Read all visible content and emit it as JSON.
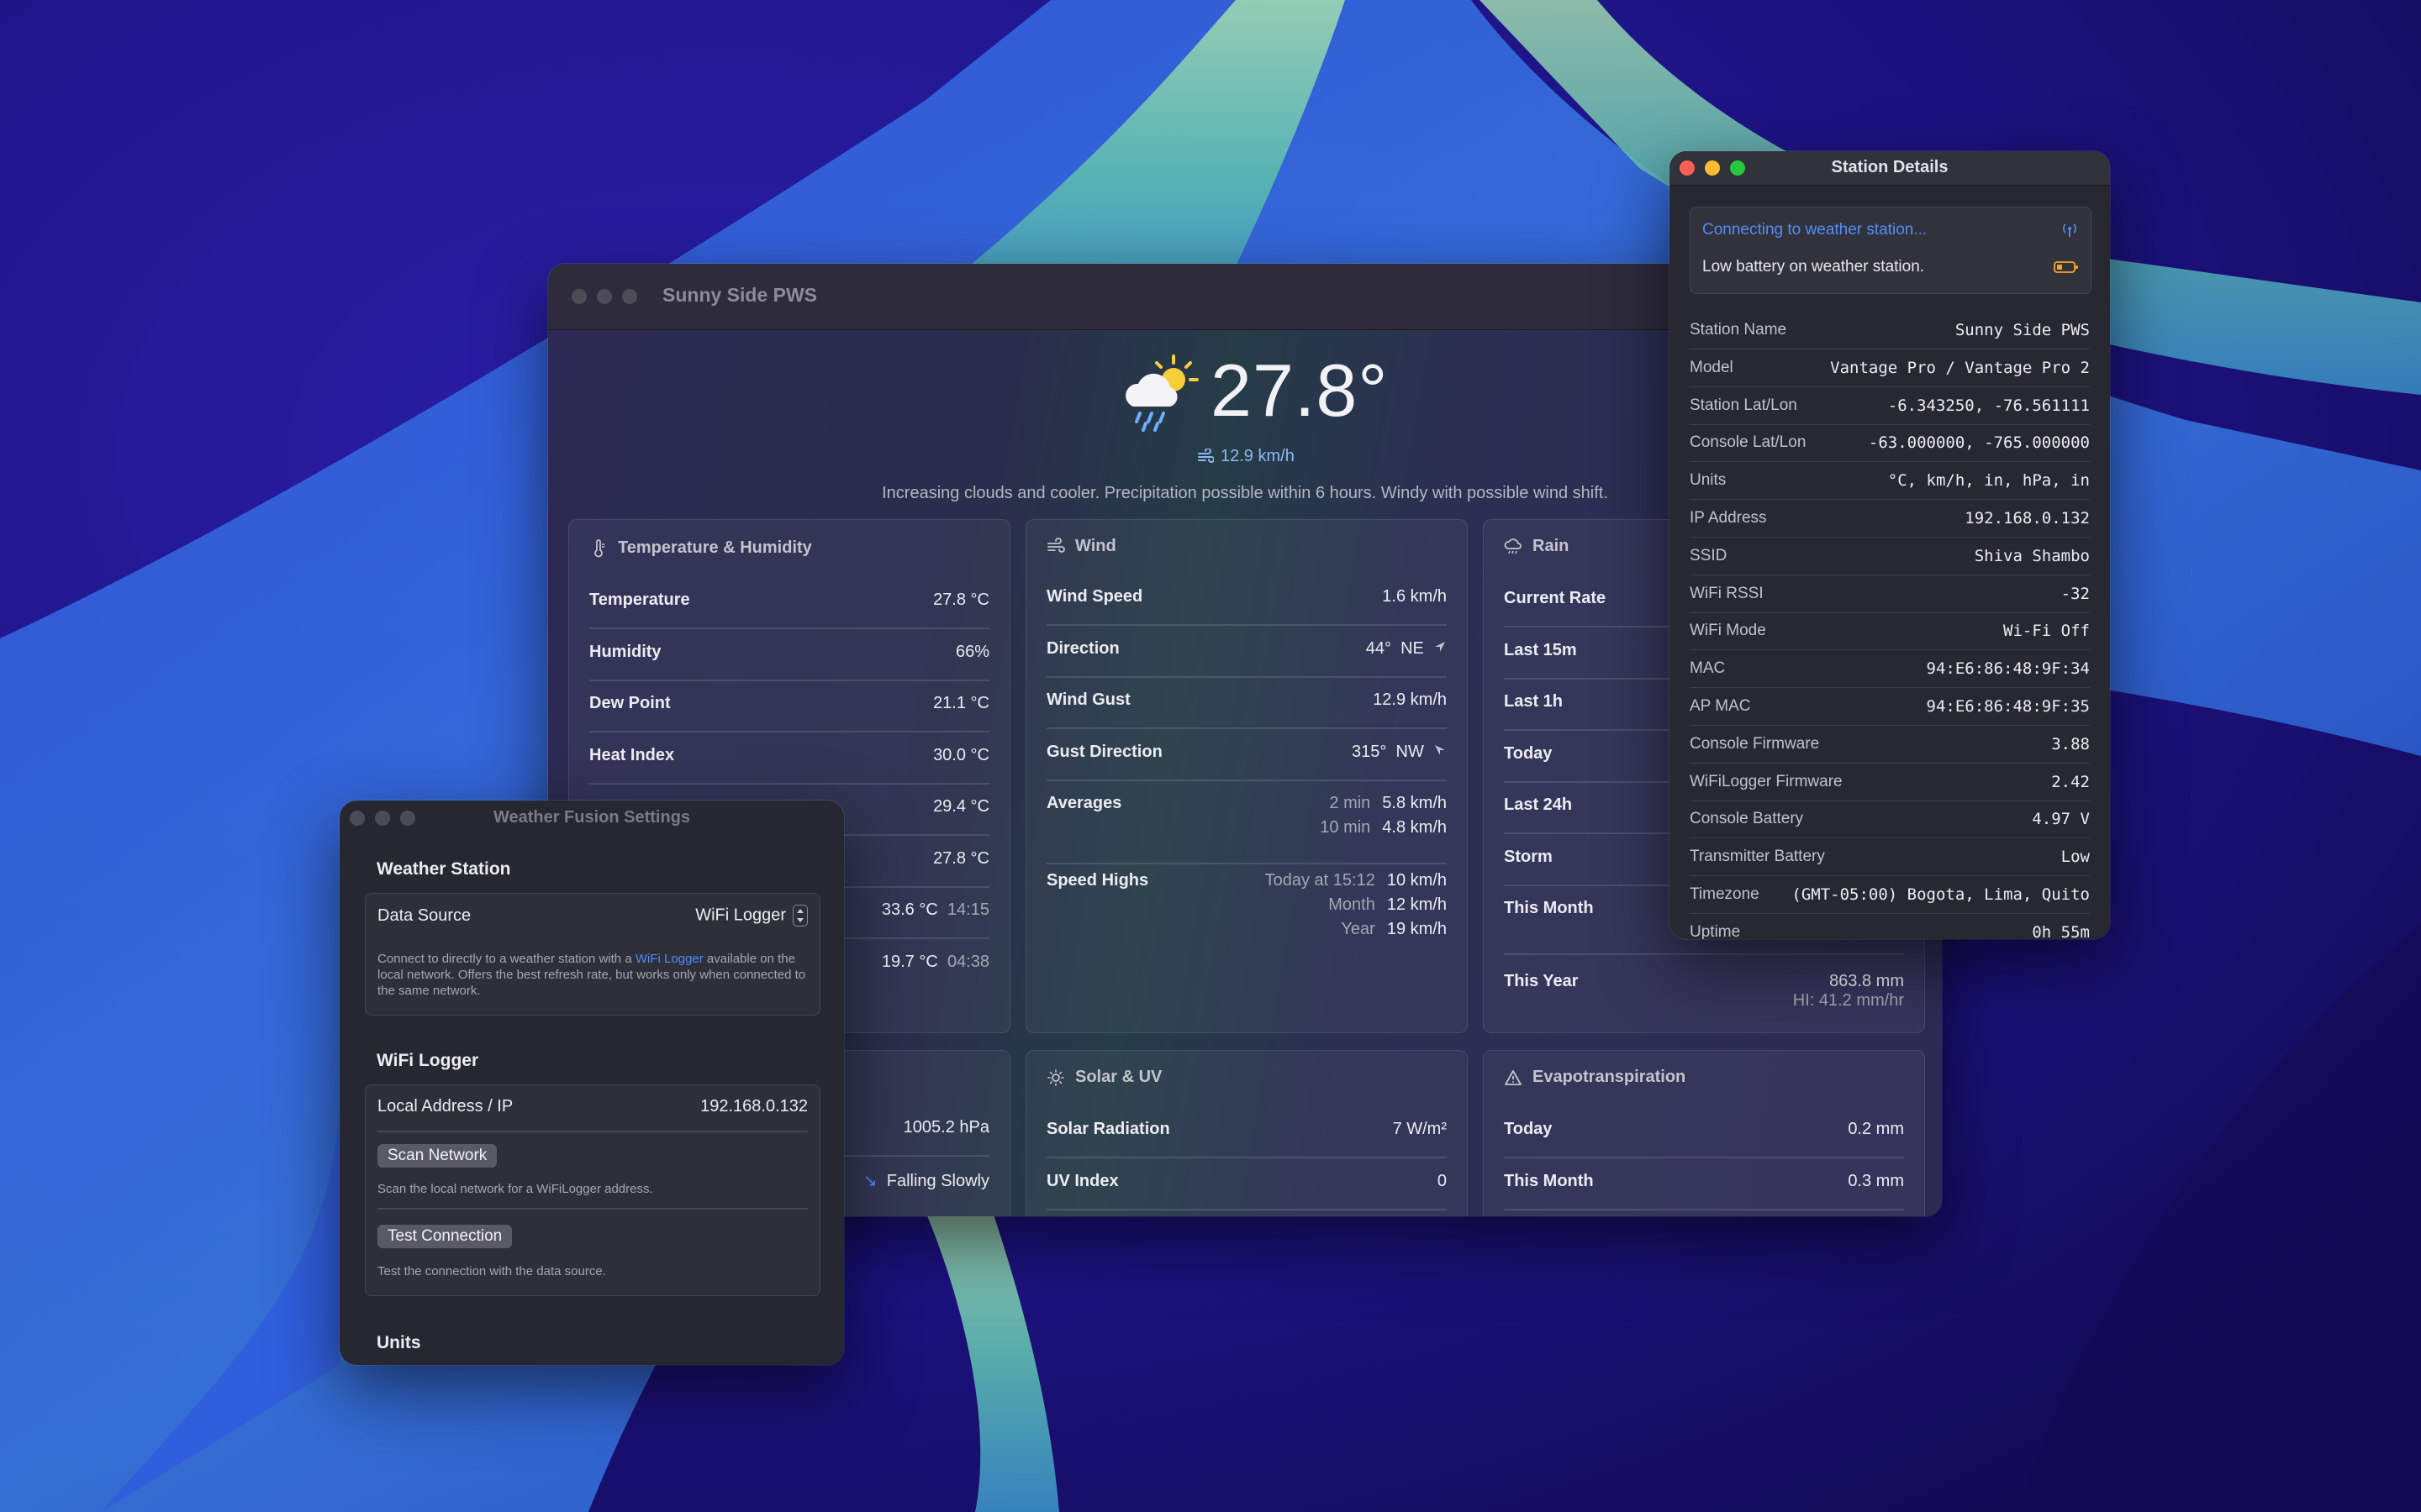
{
  "main_window": {
    "title": "Sunny Side PWS",
    "current": {
      "temperature": "27.8°",
      "wind": "12.9 km/h",
      "forecast": "Increasing clouds and cooler. Precipitation possible within 6 hours. Windy with possible wind shift."
    },
    "temperature_humidity": {
      "title": "Temperature & Humidity",
      "rows": [
        {
          "label": "Temperature",
          "value": "27.8 °C"
        },
        {
          "label": "Humidity",
          "value": "66%"
        },
        {
          "label": "Dew Point",
          "value": "21.1 °C"
        },
        {
          "label": "Heat Index",
          "value": "30.0 °C"
        },
        {
          "label": "",
          "value": "29.4 °C"
        },
        {
          "label": "",
          "value": "27.8 °C"
        },
        {
          "label": "",
          "value": "33.6 °C",
          "time": "14:15"
        },
        {
          "label": "",
          "value": "19.7 °C",
          "time": "04:38"
        }
      ]
    },
    "wind": {
      "title": "Wind",
      "speed_label": "Wind Speed",
      "speed": "1.6 km/h",
      "direction_label": "Direction",
      "direction_deg": "44°",
      "direction_card": "NE",
      "gust_label": "Wind Gust",
      "gust": "12.9 km/h",
      "gust_dir_label": "Gust Direction",
      "gust_dir_deg": "315°",
      "gust_dir_card": "NW",
      "averages_label": "Averages",
      "averages": [
        {
          "period": "2 min",
          "value": "5.8 km/h"
        },
        {
          "period": "10 min",
          "value": "4.8 km/h"
        }
      ],
      "highs_label": "Speed Highs",
      "highs": [
        {
          "period": "Today at 15:12",
          "value": "10 km/h"
        },
        {
          "period": "Month",
          "value": "12 km/h"
        },
        {
          "period": "Year",
          "value": "19 km/h"
        }
      ]
    },
    "rain": {
      "title": "Rain",
      "rows": [
        "Current Rate",
        "Last 15m",
        "Last 1h",
        "Today",
        "Last 24h",
        "Storm",
        "This Month"
      ],
      "year_label": "This Year",
      "year_value": "863.8 mm",
      "year_high": "HI: 41.2 mm/hr"
    },
    "pressure": {
      "value": "1005.2 hPa",
      "trend": "Falling Slowly"
    },
    "solar_uv": {
      "title": "Solar & UV",
      "rows": [
        {
          "label": "Solar Radiation",
          "value": "7 W/m²"
        },
        {
          "label": "UV Index",
          "value": "0"
        }
      ]
    },
    "evapotranspiration": {
      "title": "Evapotranspiration",
      "rows": [
        {
          "label": "Today",
          "value": "0.2 mm"
        },
        {
          "label": "This Month",
          "value": "0.3 mm"
        }
      ]
    }
  },
  "settings_window": {
    "title": "Weather Fusion Settings",
    "weather_station": {
      "title": "Weather Station",
      "data_source_label": "Data Source",
      "data_source_value": "WiFi Logger",
      "note_before": "Connect to directly to a weather station with a ",
      "note_link": "WiFi Logger",
      "note_after": " available on the local network. Offers the best refresh rate, but works only when connected to the same network."
    },
    "wifi_logger": {
      "title": "WiFi Logger",
      "address_label": "Local Address / IP",
      "address_value": "192.168.0.132",
      "scan_button": "Scan Network",
      "scan_note": "Scan the local network for a WiFiLogger address.",
      "test_button": "Test Connection",
      "test_note": "Test the connection with the data source."
    },
    "units_title": "Units"
  },
  "details_window": {
    "title": "Station Details",
    "alerts": [
      {
        "text": "Connecting to weather station...",
        "icon": "antenna-icon"
      },
      {
        "text": "Low battery on weather station.",
        "icon": "battery-low-icon"
      }
    ],
    "rows": [
      {
        "label": "Station Name",
        "value": "Sunny Side PWS"
      },
      {
        "label": "Model",
        "value": "Vantage Pro / Vantage Pro 2"
      },
      {
        "label": "Station Lat/Lon",
        "value": "-6.343250, -76.561111"
      },
      {
        "label": "Console Lat/Lon",
        "value": "-63.000000, -765.000000"
      },
      {
        "label": "Units",
        "value": "°C, km/h, in, hPa, in"
      },
      {
        "label": "IP Address",
        "value": "192.168.0.132"
      },
      {
        "label": "SSID",
        "value": "Shiva Shambo"
      },
      {
        "label": "WiFi RSSI",
        "value": "-32"
      },
      {
        "label": "WiFi Mode",
        "value": "Wi-Fi Off"
      },
      {
        "label": "MAC",
        "value": "94:E6:86:48:9F:34"
      },
      {
        "label": "AP MAC",
        "value": "94:E6:86:48:9F:35"
      },
      {
        "label": "Console Firmware",
        "value": "3.88"
      },
      {
        "label": "WiFiLogger Firmware",
        "value": "2.42"
      },
      {
        "label": "Console Battery",
        "value": "4.97 V"
      },
      {
        "label": "Transmitter Battery",
        "value": "Low"
      },
      {
        "label": "Timezone",
        "value": "(GMT-05:00) Bogota, Lima, Quito"
      },
      {
        "label": "Uptime",
        "value": "0h 55m"
      }
    ]
  },
  "colors": {
    "accent_blue": "#4f8ff7",
    "close": "#fe5f57",
    "minimize": "#febc2e",
    "zoom": "#28c840",
    "battery_warning": "#f5a623"
  }
}
